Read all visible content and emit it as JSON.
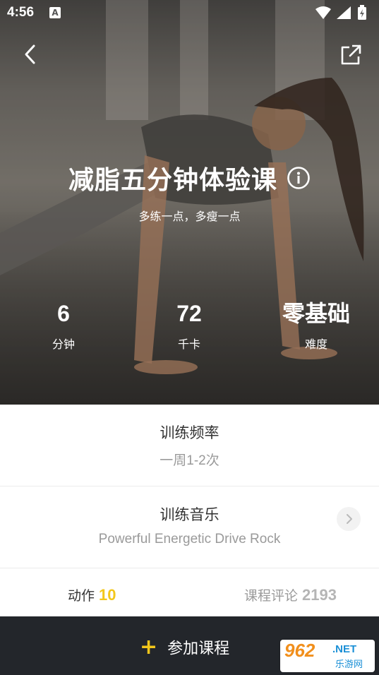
{
  "status_bar": {
    "time": "4:56",
    "notification_icon": "a-icon",
    "icons": [
      "wifi-icon",
      "signal-icon",
      "battery-charging-icon"
    ]
  },
  "header": {
    "back_icon": "chevron-left-icon",
    "share_icon": "share-external-icon"
  },
  "course": {
    "title": "减脂五分钟体验课",
    "info_icon": "info-icon",
    "subtitle": "多练一点，多瘦一点",
    "stats": [
      {
        "value": "6",
        "label": "分钟"
      },
      {
        "value": "72",
        "label": "千卡"
      },
      {
        "value": "零基础",
        "label": "难度"
      }
    ]
  },
  "training_frequency": {
    "title": "训练频率",
    "value": "一周1-2次"
  },
  "training_music": {
    "title": "训练音乐",
    "value": "Powerful Energetic Drive Rock",
    "chevron_icon": "chevron-right-icon"
  },
  "counts": {
    "actions_label": "动作",
    "actions_value": "10",
    "reviews_label": "课程评论",
    "reviews_value": "2193"
  },
  "join_button": {
    "icon": "plus-icon",
    "label": "参加课程"
  },
  "watermark": {
    "number": "962",
    "domain": ".NET",
    "name": "乐游网"
  },
  "colors": {
    "accent": "#f3c71b",
    "bottom_bar": "#23262b",
    "muted_text": "#9a9a9a"
  }
}
